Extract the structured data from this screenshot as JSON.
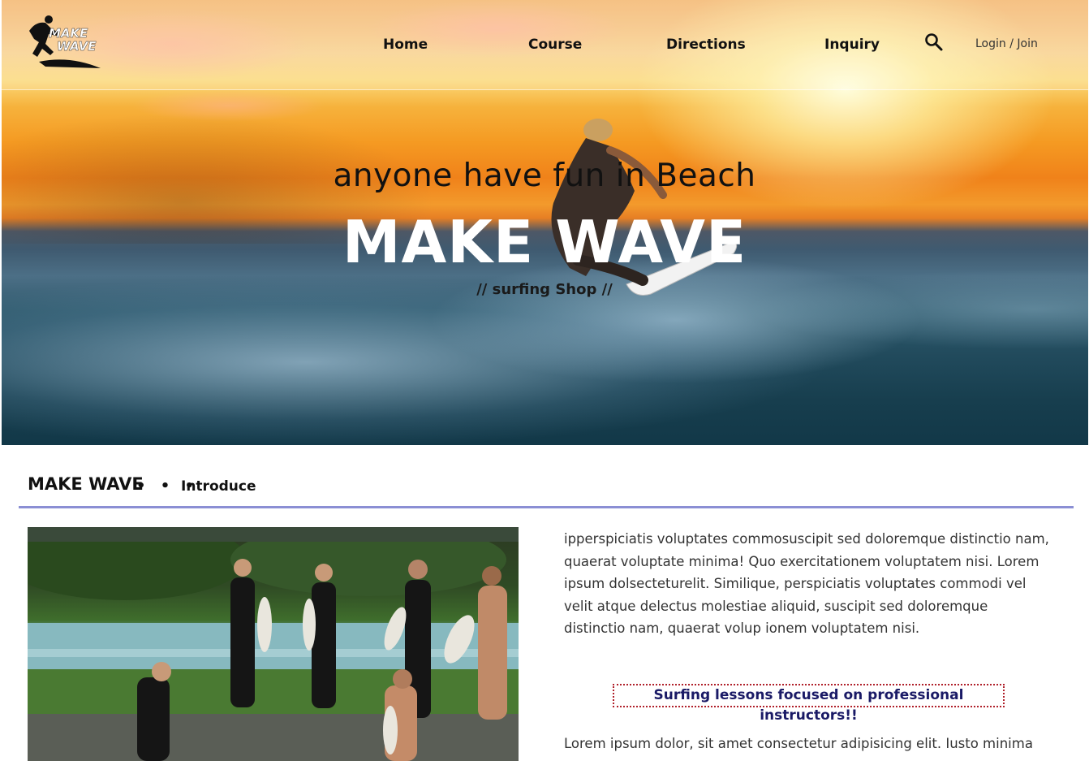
{
  "header": {
    "logo_text_line1": "MAKE",
    "logo_text_line2": "WAVE",
    "nav": [
      "Home",
      "Course",
      "Directions",
      "Inquiry"
    ],
    "search_icon": "search-icon",
    "login_label": "Login / Join"
  },
  "hero": {
    "tagline": "anyone have fun in Beach",
    "title": "MAKE WAVE",
    "subtitle": "// surfing Shop //"
  },
  "intro": {
    "title": "MAKE WAVE",
    "dots": "• • •",
    "subtitle": "Introduce",
    "paragraph1": "ipperspiciatis voluptates commosuscipit sed doloremque distinctio nam, quaerat voluptate minima! Quo exercitationem voluptatem nisi. Lorem ipsum dolsecteturelit. Similique, perspiciatis voluptates commodi vel velit atque delectus molestiae aliquid, suscipit sed doloremque distinctio nam, quaerat volup ionem voluptatem nisi.",
    "highlight": "Surfing lessons focused on professional instructors!!",
    "paragraph2": "Lorem ipsum dolor, sit amet consectetur adipisicing elit. Iusto minima"
  },
  "colors": {
    "accent_rule": "#8b8fd4",
    "highlight_border": "#b0202a",
    "highlight_text": "#1a1a66"
  }
}
